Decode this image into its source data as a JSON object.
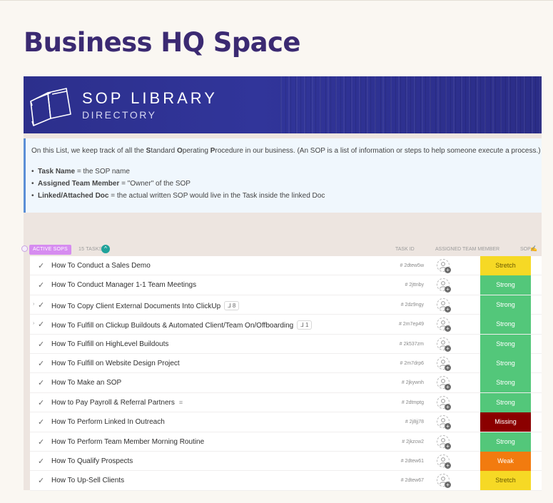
{
  "page_title": "Business HQ Space",
  "banner": {
    "title": "SOP LIBRARY",
    "subtitle": "DIRECTORY",
    "icon": "book-icon"
  },
  "description": {
    "line_parts": [
      "On this List, we keep track of all the ",
      "S",
      "tandard ",
      "O",
      "perating ",
      "P",
      "rocedure in our business. (An SOP is a list of information or steps to help someone execute a process.)"
    ],
    "items": [
      {
        "term": "Task Name",
        "text": " = the SOP name"
      },
      {
        "term": "Assigned Team Member",
        "text": " = \"Owner\" of the SOP"
      },
      {
        "term": "Linked/Attached Doc",
        "text": " = the actual written SOP would live in the Task inside the linked Doc"
      }
    ]
  },
  "list_header": {
    "group_label": "ACTIVE SOPS",
    "task_count": "15 TASKS",
    "columns": {
      "task_id": "TASK ID",
      "assigned": "ASSIGNED TEAM MEMBER",
      "sop": "SOP",
      "sop_emoji": "✍️"
    }
  },
  "tasks": [
    {
      "name": "How To Conduct a Sales Demo",
      "id": "# 2dtew5w",
      "sop": "Stretch",
      "expander": false,
      "subtasks": "",
      "has_description": false
    },
    {
      "name": "How To Conduct Manager 1-1 Team Meetings",
      "id": "# 2jttnby",
      "sop": "Strong",
      "expander": false,
      "subtasks": "",
      "has_description": false
    },
    {
      "name": "How To Copy Client External Documents Into ClickUp",
      "id": "# 2dz9ngy",
      "sop": "Strong",
      "expander": true,
      "subtasks": "8",
      "has_description": false
    },
    {
      "name": "How To Fulfill on Clickup Buildouts & Automated Client/Team On/Offboarding",
      "id": "# 2m7ep49",
      "sop": "Strong",
      "expander": true,
      "subtasks": "1",
      "has_description": false
    },
    {
      "name": "How To Fulfill on HighLevel Buildouts",
      "id": "# 2k537zm",
      "sop": "Strong",
      "expander": false,
      "subtasks": "",
      "has_description": false
    },
    {
      "name": "How To Fulfill on Website Design Project",
      "id": "# 2m7drp6",
      "sop": "Strong",
      "expander": false,
      "subtasks": "",
      "has_description": false
    },
    {
      "name": "How To Make an SOP",
      "id": "# 2jkywnh",
      "sop": "Strong",
      "expander": false,
      "subtasks": "",
      "has_description": false
    },
    {
      "name": "How to Pay Payroll & Referral Partners",
      "id": "# 2dtmptg",
      "sop": "Strong",
      "expander": false,
      "subtasks": "",
      "has_description": true
    },
    {
      "name": "How To Perform Linked In Outreach",
      "id": "# 2j8jj78",
      "sop": "Missing",
      "expander": false,
      "subtasks": "",
      "has_description": false
    },
    {
      "name": "How To Perform Team Member Morning Routine",
      "id": "# 2jkzcw2",
      "sop": "Strong",
      "expander": false,
      "subtasks": "",
      "has_description": false
    },
    {
      "name": "How To Qualify Prospects",
      "id": "# 2dtew61",
      "sop": "Weak",
      "expander": false,
      "subtasks": "",
      "has_description": false
    },
    {
      "name": "How To Up-Sell Clients",
      "id": "# 2dtew67",
      "sop": "Stretch",
      "expander": false,
      "subtasks": "",
      "has_description": false
    }
  ],
  "sop_colors": {
    "Stretch": "#f6d925",
    "Strong": "#53c77a",
    "Missing": "#8b0000",
    "Weak": "#f27b0f"
  },
  "icons": {
    "check": "check-icon",
    "subtask": "subtask-icon",
    "description": "description-icon",
    "avatar": "add-assignee-icon"
  }
}
